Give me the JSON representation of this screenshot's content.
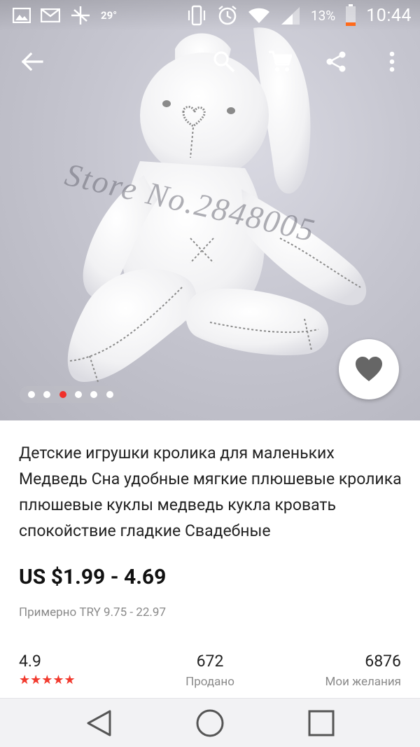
{
  "status_bar": {
    "temperature": "29°",
    "battery_percent": "13%",
    "time": "10:44"
  },
  "hero": {
    "watermark": "Store No.2848005",
    "carousel": {
      "count": 6,
      "active_index": 2
    }
  },
  "product": {
    "title": "Детские игрушки кролика для маленьких Медведь Сна удобные мягкие плюшевые кролика плюшевые куклы медведь кукла кровать спокойствие гладкие Свадебные",
    "price": "US $1.99 - 4.69",
    "approx_price": "Примерно TRY 9.75 - 22.97"
  },
  "stats": {
    "rating": "4.9",
    "stars": "★★★★★",
    "sold_value": "672",
    "sold_label": "Продано",
    "wishlist_value": "6876",
    "wishlist_label": "Мои желания"
  },
  "colors": {
    "accent": "#f0302a",
    "text": "#222222",
    "muted": "#8a8a8a"
  }
}
